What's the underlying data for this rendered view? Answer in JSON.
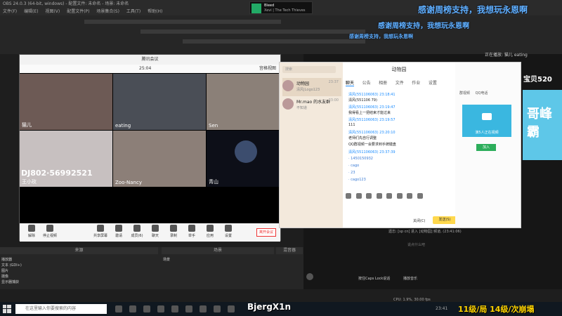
{
  "obs": {
    "title": "OBS 24.0.3 (64-bit, windows) - 配置文件: 未命名 - 场景: 未命名",
    "menu": [
      "文件(F)",
      "编辑(E)",
      "视图(V)",
      "配置文件(P)",
      "场景集合(S)",
      "工具(T)",
      "帮助(H)"
    ],
    "docks": {
      "sources_title": "来源",
      "scenes_title": "场景",
      "mixer_title": "混音器",
      "scene_items": [
        "播放器",
        "文本 (GDI+)",
        "图片",
        "摄像",
        "显示器捕获"
      ],
      "scene_label": "场景"
    }
  },
  "scrolling": {
    "line1": "感谢周榜支持，我想玩永恩啊",
    "line2": "感谢周榜支持，我想玩永恩啊",
    "line3": "感谢周榜支持，我想玩永恩啊"
  },
  "spotify_widget": {
    "title": "Bleed",
    "artist": "Xevi | The Tech Thieves"
  },
  "meeting": {
    "title": "腾讯会议",
    "time": "25:04",
    "view_label": "宫格视图",
    "participants": [
      {
        "name": "猫儿"
      },
      {
        "name": "eating"
      },
      {
        "name": "Sen"
      },
      {
        "name": "王小玫"
      },
      {
        "name": "Zoo-Nancy"
      },
      {
        "name": "青山"
      }
    ],
    "overlay_text": "DJ802·56992521",
    "toolbar": [
      "解除",
      "停止视频",
      "共享屏幕",
      "邀请",
      "成员(6)",
      "聊天",
      "录制",
      "举手",
      "应用",
      "设置"
    ],
    "end_button": "离开会议"
  },
  "qq": {
    "search_placeholder": "搜索",
    "contacts": [
      {
        "name": "动物园",
        "sub": "清风|Logo123",
        "time": "23:37"
      },
      {
        "name": "Mr.mao 的水友群",
        "sub": "不知道",
        "time": "23:00"
      }
    ],
    "chat_title": "动物园",
    "tabs": [
      "聊天",
      "公告",
      "相册",
      "文件",
      "作业",
      "设置"
    ],
    "messages": [
      {
        "name": "清风(551106063)",
        "time": "23:18:41",
        "body": "清风(551106 79)"
      },
      {
        "name": "清风(551106063)",
        "time": "23:19:47",
        "body": "我得看上一把结束才能过来"
      },
      {
        "name": "清风(551106063)",
        "time": "23:19:57",
        "body": "111"
      },
      {
        "name": "清风(551106063)",
        "time": "23:20:10",
        "body": "老师们先自行调整"
      },
      {
        "name": "",
        "time": "",
        "body": "QQ群视频一会要求到手牌键盘"
      },
      {
        "name": "清风(551106063)",
        "time": "23:37:39",
        "body": ""
      }
    ],
    "list_items": [
      "· 1450150932",
      "· cago",
      "· 23",
      "· cago123"
    ],
    "close_label": "关闭(C)",
    "send_label": "发送(S)",
    "right_tabs": [
      "群视频",
      "QQ电话"
    ],
    "video_label": "演5人正在视频",
    "join_label": "加入"
  },
  "right_panel": {
    "now_playing": "正在播放: 猫儿 eating",
    "chat_entry": "遗忘: [sp cn] 进入 [动物园] 频道, (23:41:06)",
    "input_placeholder": "说点什么吧",
    "banner_text": "哥峰霸",
    "banner_sub": "宝贝520",
    "music_label": "播放音乐",
    "capture_label": "按住Caps Lock说话"
  },
  "taskbar": {
    "search_placeholder": "在这里输入你要搜索的内容",
    "user_id": "BjergX1n",
    "bottom_text": "11级/局 14级/次崩塌",
    "tray_stats": "CPU: 1.9%, 30.00 fps",
    "clock": "23:41"
  },
  "colors": {
    "accent": "#1a8cff",
    "send": "#ffd84d",
    "scroll_text": "#5fb0ff",
    "banner": "#5ec7e8",
    "join": "#2dae5b"
  }
}
